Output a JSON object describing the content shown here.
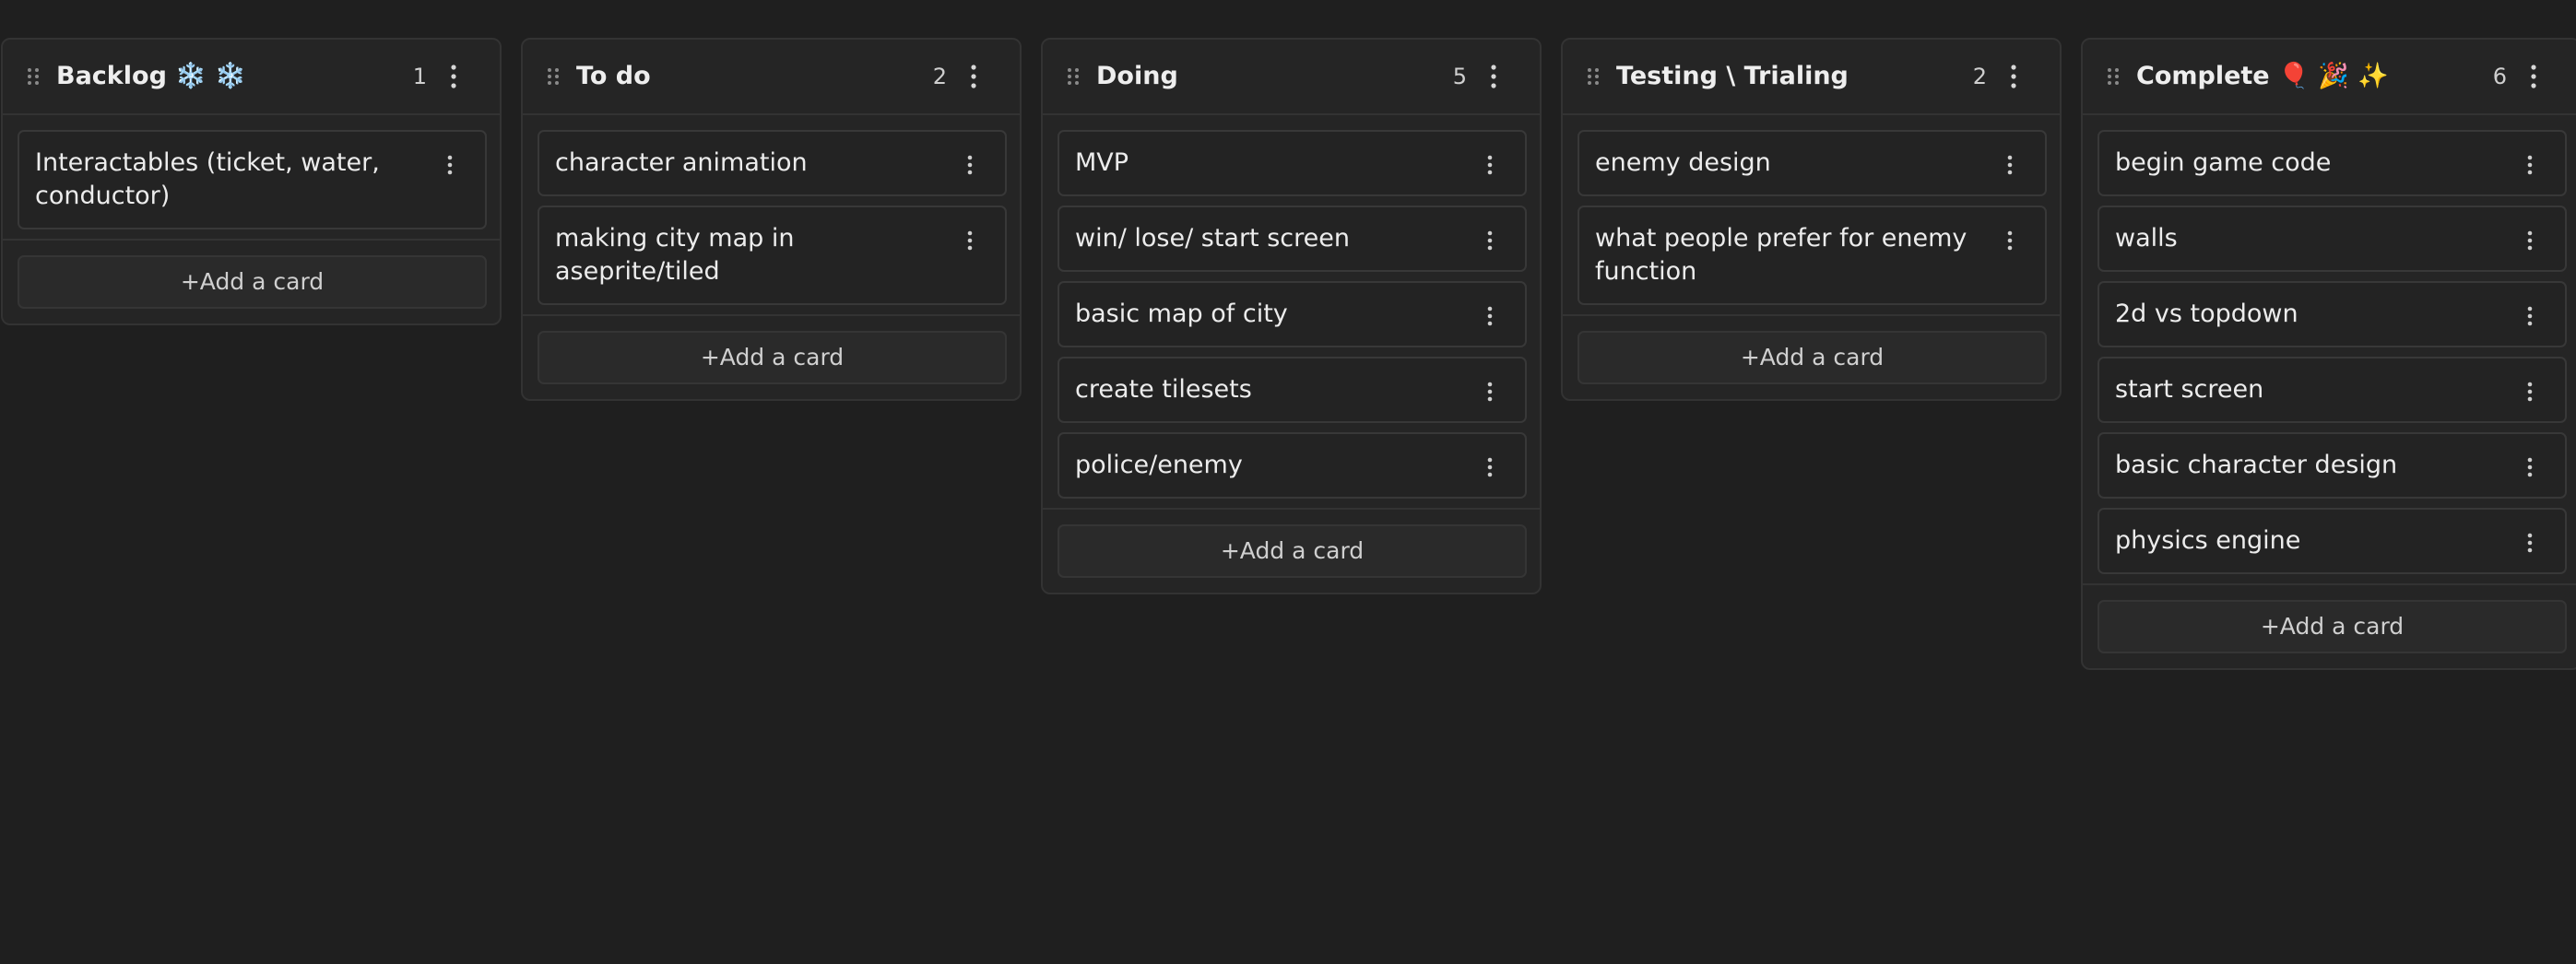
{
  "add_card_label": "+Add a card",
  "columns": [
    {
      "title": "Backlog",
      "title_suffix": "❄️ ❄️",
      "count": "1",
      "cards": [
        "Interactables (ticket, water, conductor)"
      ]
    },
    {
      "title": "To do",
      "title_suffix": "",
      "count": "2",
      "cards": [
        "character animation",
        "making city map in aseprite/tiled"
      ]
    },
    {
      "title": "Doing",
      "title_suffix": "",
      "count": "5",
      "cards": [
        "MVP",
        "win/ lose/ start screen",
        "basic map of city",
        "create tilesets",
        "police/enemy"
      ]
    },
    {
      "title": "Testing \\ Trialing",
      "title_suffix": "",
      "count": "2",
      "cards": [
        "enemy design",
        "what people prefer for enemy function"
      ]
    },
    {
      "title": "Complete",
      "title_suffix": "🎈 🎉 ✨",
      "count": "6",
      "cards": [
        "begin game code",
        "walls",
        "2d vs topdown",
        "start screen",
        "basic character design",
        "physics engine"
      ]
    }
  ],
  "icons": {
    "drag_handle": "drag-handle-icon",
    "column_menu": "kebab-menu-icon",
    "card_menu": "kebab-menu-icon"
  },
  "colors": {
    "background": "#1f1f1f",
    "column": "#252525",
    "card": "#232323",
    "snowflake": "#4aa8e8"
  }
}
